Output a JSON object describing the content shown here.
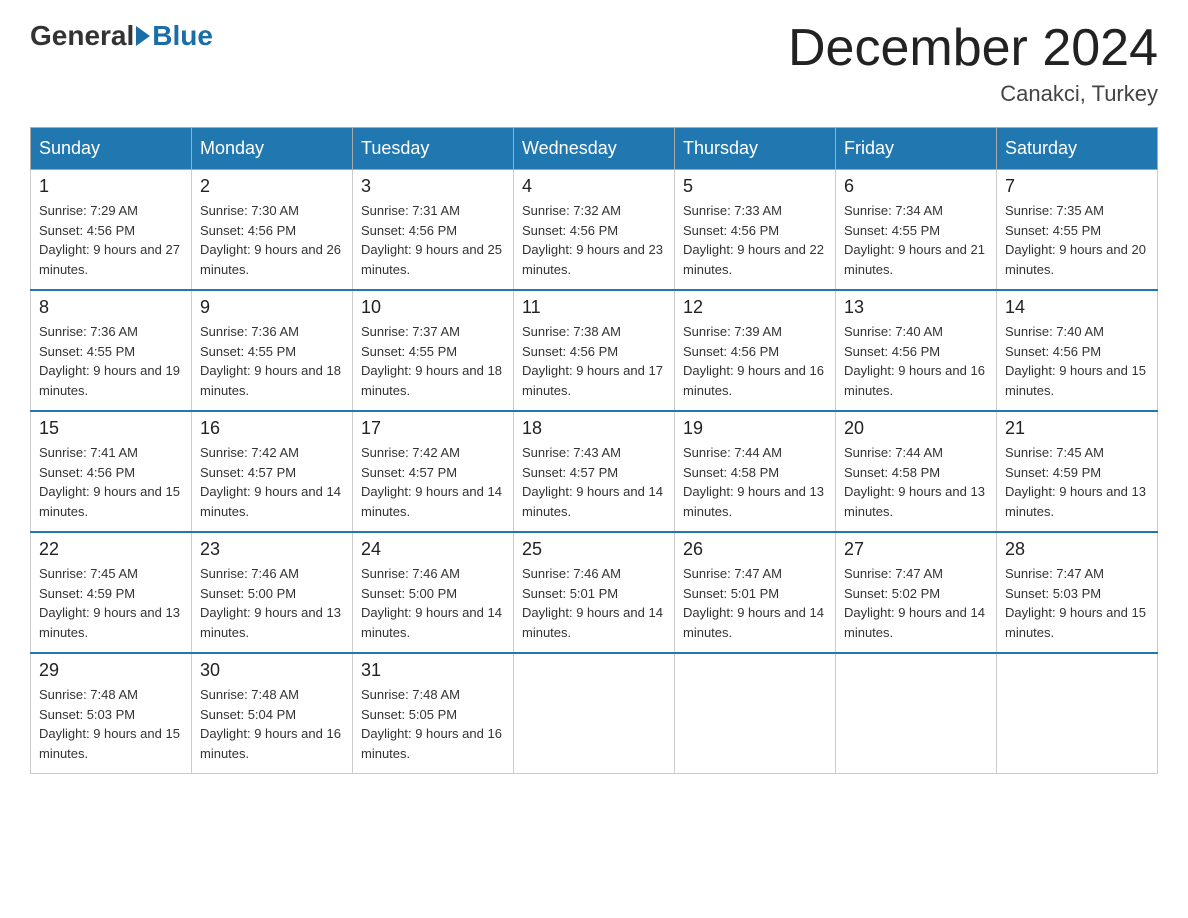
{
  "logo": {
    "general": "General",
    "blue": "Blue"
  },
  "title": "December 2024",
  "location": "Canakci, Turkey",
  "days_of_week": [
    "Sunday",
    "Monday",
    "Tuesday",
    "Wednesday",
    "Thursday",
    "Friday",
    "Saturday"
  ],
  "weeks": [
    [
      {
        "day": "1",
        "sunrise": "7:29 AM",
        "sunset": "4:56 PM",
        "daylight": "9 hours and 27 minutes."
      },
      {
        "day": "2",
        "sunrise": "7:30 AM",
        "sunset": "4:56 PM",
        "daylight": "9 hours and 26 minutes."
      },
      {
        "day": "3",
        "sunrise": "7:31 AM",
        "sunset": "4:56 PM",
        "daylight": "9 hours and 25 minutes."
      },
      {
        "day": "4",
        "sunrise": "7:32 AM",
        "sunset": "4:56 PM",
        "daylight": "9 hours and 23 minutes."
      },
      {
        "day": "5",
        "sunrise": "7:33 AM",
        "sunset": "4:56 PM",
        "daylight": "9 hours and 22 minutes."
      },
      {
        "day": "6",
        "sunrise": "7:34 AM",
        "sunset": "4:55 PM",
        "daylight": "9 hours and 21 minutes."
      },
      {
        "day": "7",
        "sunrise": "7:35 AM",
        "sunset": "4:55 PM",
        "daylight": "9 hours and 20 minutes."
      }
    ],
    [
      {
        "day": "8",
        "sunrise": "7:36 AM",
        "sunset": "4:55 PM",
        "daylight": "9 hours and 19 minutes."
      },
      {
        "day": "9",
        "sunrise": "7:36 AM",
        "sunset": "4:55 PM",
        "daylight": "9 hours and 18 minutes."
      },
      {
        "day": "10",
        "sunrise": "7:37 AM",
        "sunset": "4:55 PM",
        "daylight": "9 hours and 18 minutes."
      },
      {
        "day": "11",
        "sunrise": "7:38 AM",
        "sunset": "4:56 PM",
        "daylight": "9 hours and 17 minutes."
      },
      {
        "day": "12",
        "sunrise": "7:39 AM",
        "sunset": "4:56 PM",
        "daylight": "9 hours and 16 minutes."
      },
      {
        "day": "13",
        "sunrise": "7:40 AM",
        "sunset": "4:56 PM",
        "daylight": "9 hours and 16 minutes."
      },
      {
        "day": "14",
        "sunrise": "7:40 AM",
        "sunset": "4:56 PM",
        "daylight": "9 hours and 15 minutes."
      }
    ],
    [
      {
        "day": "15",
        "sunrise": "7:41 AM",
        "sunset": "4:56 PM",
        "daylight": "9 hours and 15 minutes."
      },
      {
        "day": "16",
        "sunrise": "7:42 AM",
        "sunset": "4:57 PM",
        "daylight": "9 hours and 14 minutes."
      },
      {
        "day": "17",
        "sunrise": "7:42 AM",
        "sunset": "4:57 PM",
        "daylight": "9 hours and 14 minutes."
      },
      {
        "day": "18",
        "sunrise": "7:43 AM",
        "sunset": "4:57 PM",
        "daylight": "9 hours and 14 minutes."
      },
      {
        "day": "19",
        "sunrise": "7:44 AM",
        "sunset": "4:58 PM",
        "daylight": "9 hours and 13 minutes."
      },
      {
        "day": "20",
        "sunrise": "7:44 AM",
        "sunset": "4:58 PM",
        "daylight": "9 hours and 13 minutes."
      },
      {
        "day": "21",
        "sunrise": "7:45 AM",
        "sunset": "4:59 PM",
        "daylight": "9 hours and 13 minutes."
      }
    ],
    [
      {
        "day": "22",
        "sunrise": "7:45 AM",
        "sunset": "4:59 PM",
        "daylight": "9 hours and 13 minutes."
      },
      {
        "day": "23",
        "sunrise": "7:46 AM",
        "sunset": "5:00 PM",
        "daylight": "9 hours and 13 minutes."
      },
      {
        "day": "24",
        "sunrise": "7:46 AM",
        "sunset": "5:00 PM",
        "daylight": "9 hours and 14 minutes."
      },
      {
        "day": "25",
        "sunrise": "7:46 AM",
        "sunset": "5:01 PM",
        "daylight": "9 hours and 14 minutes."
      },
      {
        "day": "26",
        "sunrise": "7:47 AM",
        "sunset": "5:01 PM",
        "daylight": "9 hours and 14 minutes."
      },
      {
        "day": "27",
        "sunrise": "7:47 AM",
        "sunset": "5:02 PM",
        "daylight": "9 hours and 14 minutes."
      },
      {
        "day": "28",
        "sunrise": "7:47 AM",
        "sunset": "5:03 PM",
        "daylight": "9 hours and 15 minutes."
      }
    ],
    [
      {
        "day": "29",
        "sunrise": "7:48 AM",
        "sunset": "5:03 PM",
        "daylight": "9 hours and 15 minutes."
      },
      {
        "day": "30",
        "sunrise": "7:48 AM",
        "sunset": "5:04 PM",
        "daylight": "9 hours and 16 minutes."
      },
      {
        "day": "31",
        "sunrise": "7:48 AM",
        "sunset": "5:05 PM",
        "daylight": "9 hours and 16 minutes."
      },
      null,
      null,
      null,
      null
    ]
  ]
}
